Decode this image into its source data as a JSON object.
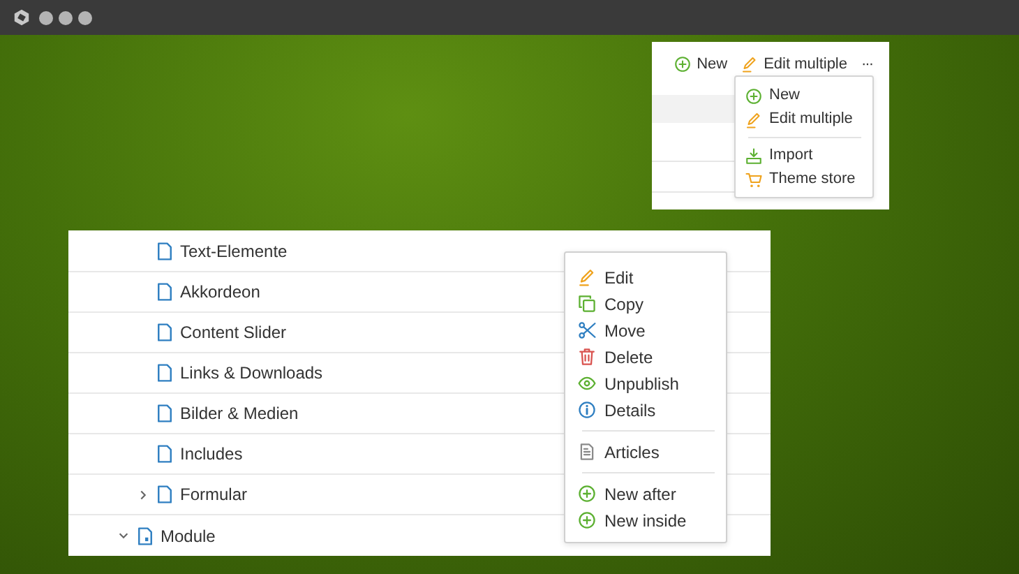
{
  "toolbar": [
    {
      "kind": "new",
      "label": "New"
    },
    {
      "kind": "edit",
      "label": "Edit multiple"
    },
    {
      "kind": "more",
      "label": "···"
    }
  ],
  "toolbar_menu": [
    {
      "kind": "new",
      "label": "New"
    },
    {
      "kind": "edit",
      "label": "Edit multiple"
    },
    {
      "kind": "separator"
    },
    {
      "kind": "import",
      "label": "Import"
    },
    {
      "kind": "store",
      "label": "Theme store"
    }
  ],
  "tree": [
    {
      "children": [
        {
          "label": "Text-Elemente"
        },
        {
          "label": "Akkordeon"
        },
        {
          "label": "Content Slider"
        },
        {
          "label": "Links & Downloads"
        },
        {
          "label": "Bilder & Medien"
        },
        {
          "label": "Includes"
        },
        {
          "label": "Formular",
          "expanded": false
        }
      ]
    },
    {
      "label": "Module",
      "expanded": true,
      "kind": "module"
    }
  ],
  "context_menu": [
    {
      "kind": "edit",
      "label": "Edit"
    },
    {
      "kind": "copy",
      "label": "Copy"
    },
    {
      "kind": "move",
      "label": "Move"
    },
    {
      "kind": "delete",
      "label": "Delete"
    },
    {
      "kind": "unpublish",
      "label": "Unpublish"
    },
    {
      "kind": "details",
      "label": "Details"
    },
    {
      "kind": "separator"
    },
    {
      "kind": "articles",
      "label": "Articles"
    },
    {
      "kind": "separator"
    },
    {
      "kind": "new",
      "label": "New after"
    },
    {
      "kind": "new",
      "label": "New inside"
    }
  ]
}
